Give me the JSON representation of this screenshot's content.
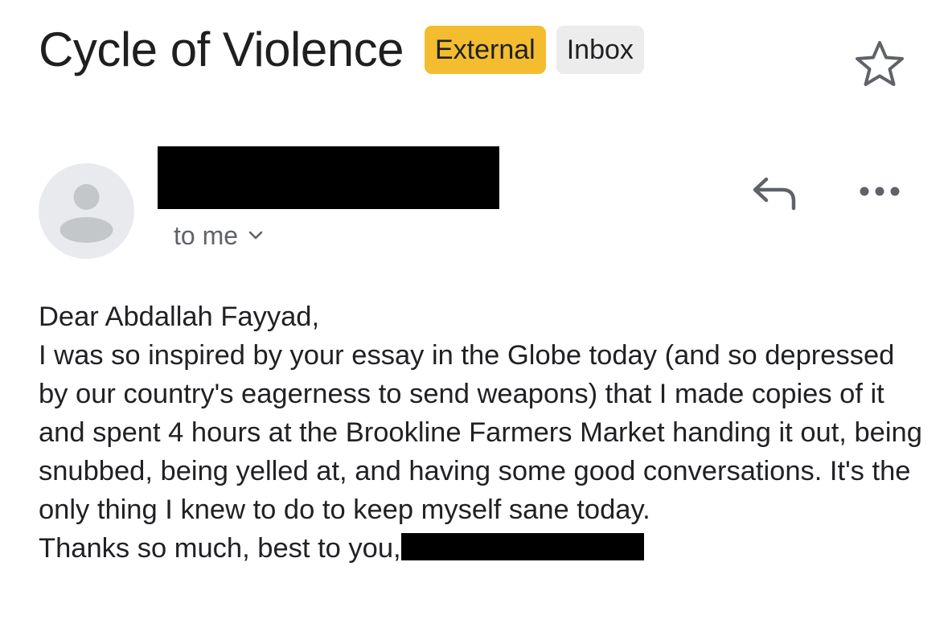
{
  "email": {
    "subject": "Cycle of Violence",
    "labels": [
      {
        "text": "External",
        "color": "#f3bd2f"
      },
      {
        "text": "Inbox",
        "color": "#ececec"
      }
    ],
    "recipient_text": "to me",
    "icons": {
      "star": "star-icon",
      "reply": "reply-icon",
      "more": "more-horizontal-icon",
      "avatar": "default-avatar-icon",
      "recipient_expand": "chevron-down-icon"
    },
    "body": {
      "greeting": "Dear Abdallah Fayyad,",
      "paragraph": "I was so inspired by your essay in the Globe today (and so depressed by our country's eagerness to send weapons) that I made copies of it and spent 4 hours at the Brookline Farmers Market handing it out, being snubbed, being yelled at, and having some good conversations. It's the only thing I knew to do to keep myself sane today.",
      "signoff": "Thanks so much, best to you,"
    }
  }
}
